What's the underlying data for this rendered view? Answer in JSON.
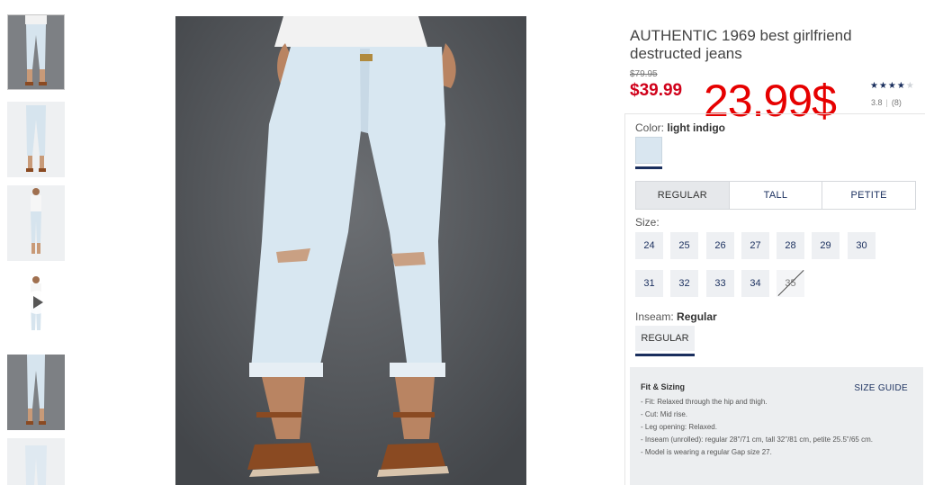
{
  "product": {
    "title": "AUTHENTIC 1969 best girlfriend destructed jeans",
    "old_price": "$79.95",
    "price": "$39.99",
    "overlay_price": "23.99$",
    "stars": "★★★★",
    "star_empty": "★",
    "rating_value": "3.8",
    "rating_sep": "|",
    "rating_count": "(8)"
  },
  "color": {
    "label": "Color:",
    "value": "light indigo",
    "swatch_hex": "#d9e6f0"
  },
  "fit_tabs": [
    {
      "label": "REGULAR",
      "active": true
    },
    {
      "label": "TALL",
      "active": false
    },
    {
      "label": "PETITE",
      "active": false
    }
  ],
  "sizes": {
    "label": "Size:",
    "row1": [
      "24",
      "25",
      "26",
      "27",
      "28",
      "29",
      "30"
    ],
    "row2": [
      "31",
      "32",
      "33",
      "34",
      "35"
    ],
    "unavailable": [
      "35"
    ]
  },
  "inseam": {
    "label": "Inseam:",
    "value": "Regular",
    "button": "REGULAR"
  },
  "fit_sizing": {
    "title": "Fit & Sizing",
    "size_guide": "SIZE GUIDE",
    "items": [
      "- Fit: Relaxed through the hip and thigh.",
      "- Cut: Mid rise.",
      "- Leg opening: Relaxed.",
      "- Inseam (unrolled): regular 28\"/71 cm, tall 32\"/81 cm, petite 25.5\"/65 cm.",
      "- Model is wearing a regular Gap size 27."
    ]
  },
  "colors": {
    "sale_red": "#d0021b",
    "overlay_red": "#e60000",
    "navy": "#1a2f5e"
  }
}
